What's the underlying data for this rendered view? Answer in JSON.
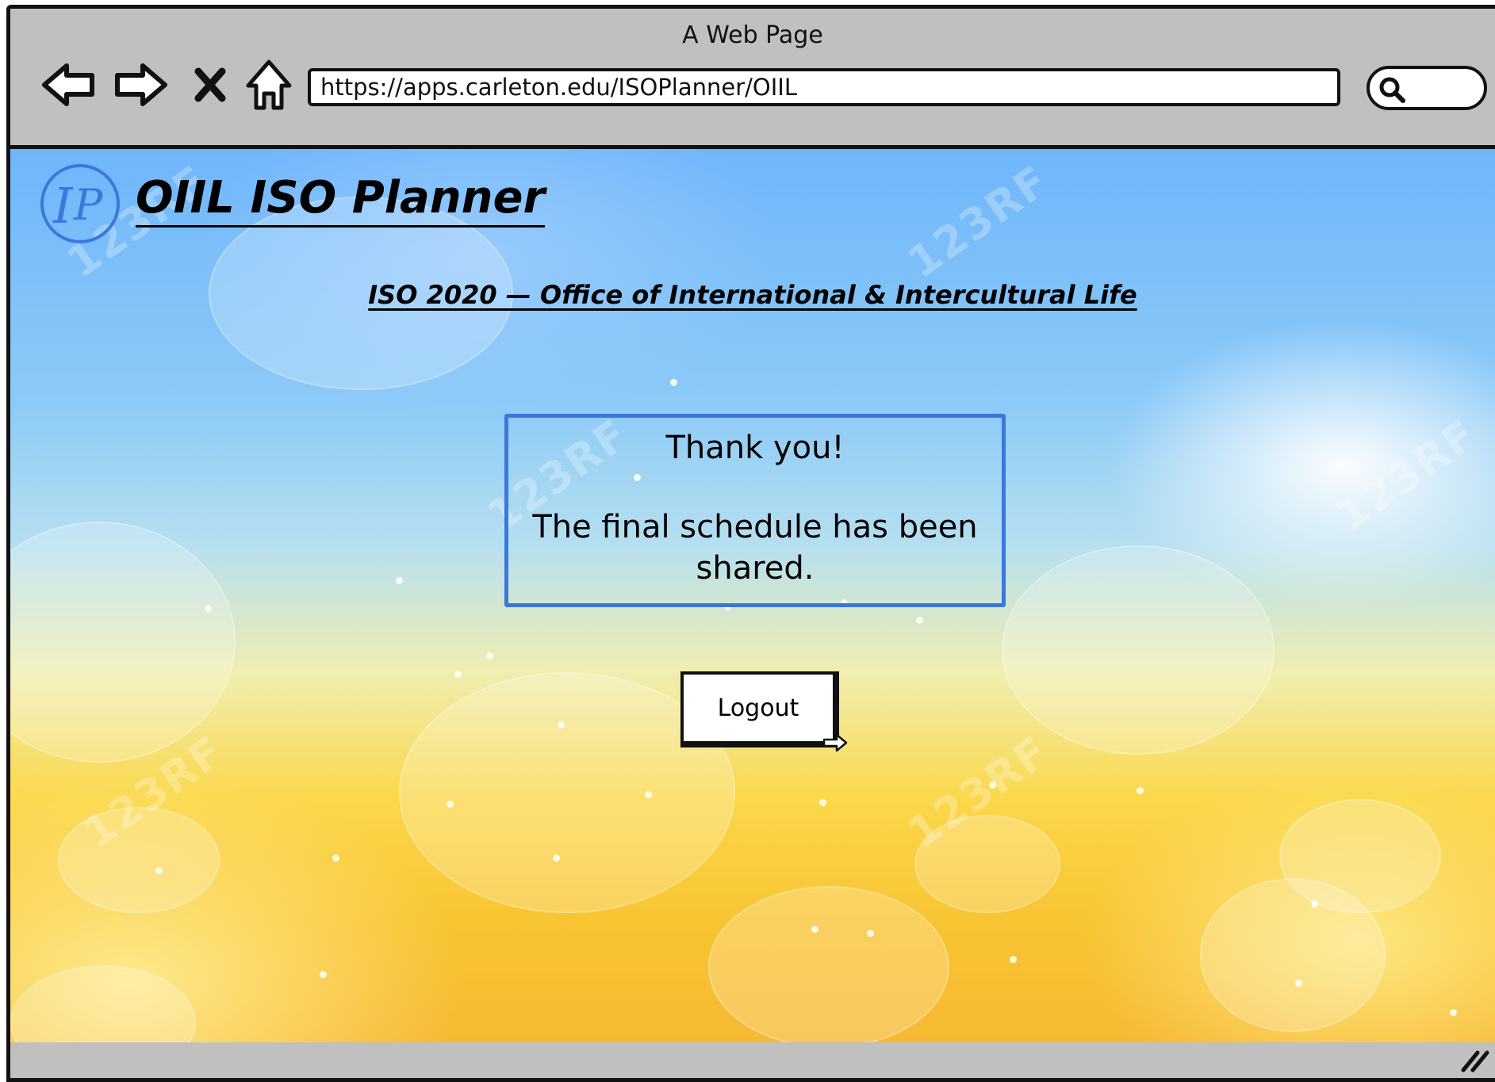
{
  "window": {
    "title": "A Web Page"
  },
  "toolbar": {
    "back_icon": "back-arrow-icon",
    "forward_icon": "forward-arrow-icon",
    "stop_icon": "close-icon",
    "home_icon": "home-icon",
    "search_icon": "search-icon"
  },
  "address_bar": {
    "url": "https://apps.carleton.edu/ISOPlanner/OIIL"
  },
  "app": {
    "logo_icon": "ip-logo-icon",
    "title": "OIIL ISO Planner",
    "subtitle": "ISO 2020 — Office of International & Intercultural Life"
  },
  "message": {
    "heading": "Thank you!",
    "body": "The final schedule has been shared."
  },
  "logout": {
    "label": "Logout"
  },
  "colors": {
    "accent_border": "#3a78dd",
    "chrome_gray": "#c0c0c0"
  }
}
